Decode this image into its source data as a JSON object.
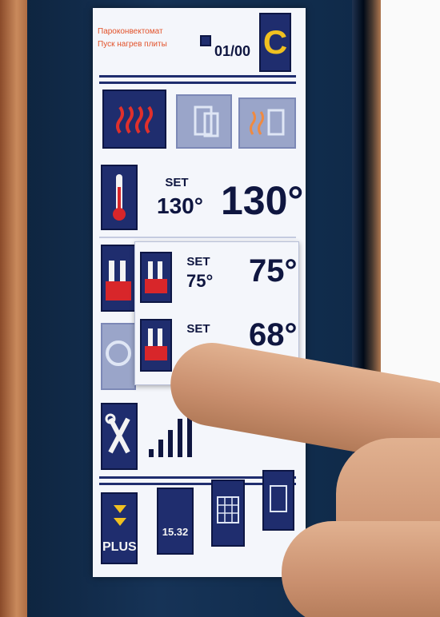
{
  "header": {
    "line1": "Пароконвектомат",
    "line2": "Пуск нагрев плиты",
    "counter": "01/00",
    "mode_letter": "C"
  },
  "temperature": {
    "set_label": "SET",
    "set_value": "130°",
    "actual_value": "130°"
  },
  "popup": {
    "row1": {
      "set_label": "SET",
      "set_value": "75°",
      "actual_value": "75°"
    },
    "row2": {
      "set_label": "SET",
      "actual_value": "68°"
    }
  },
  "bottom": {
    "plus_label": "PLUS",
    "clock_value": "15.32"
  },
  "signal_level": 5,
  "colors": {
    "screen_navy": "#1f2d6e",
    "heat_red": "#d8262a",
    "label_orange": "#e2522a"
  }
}
